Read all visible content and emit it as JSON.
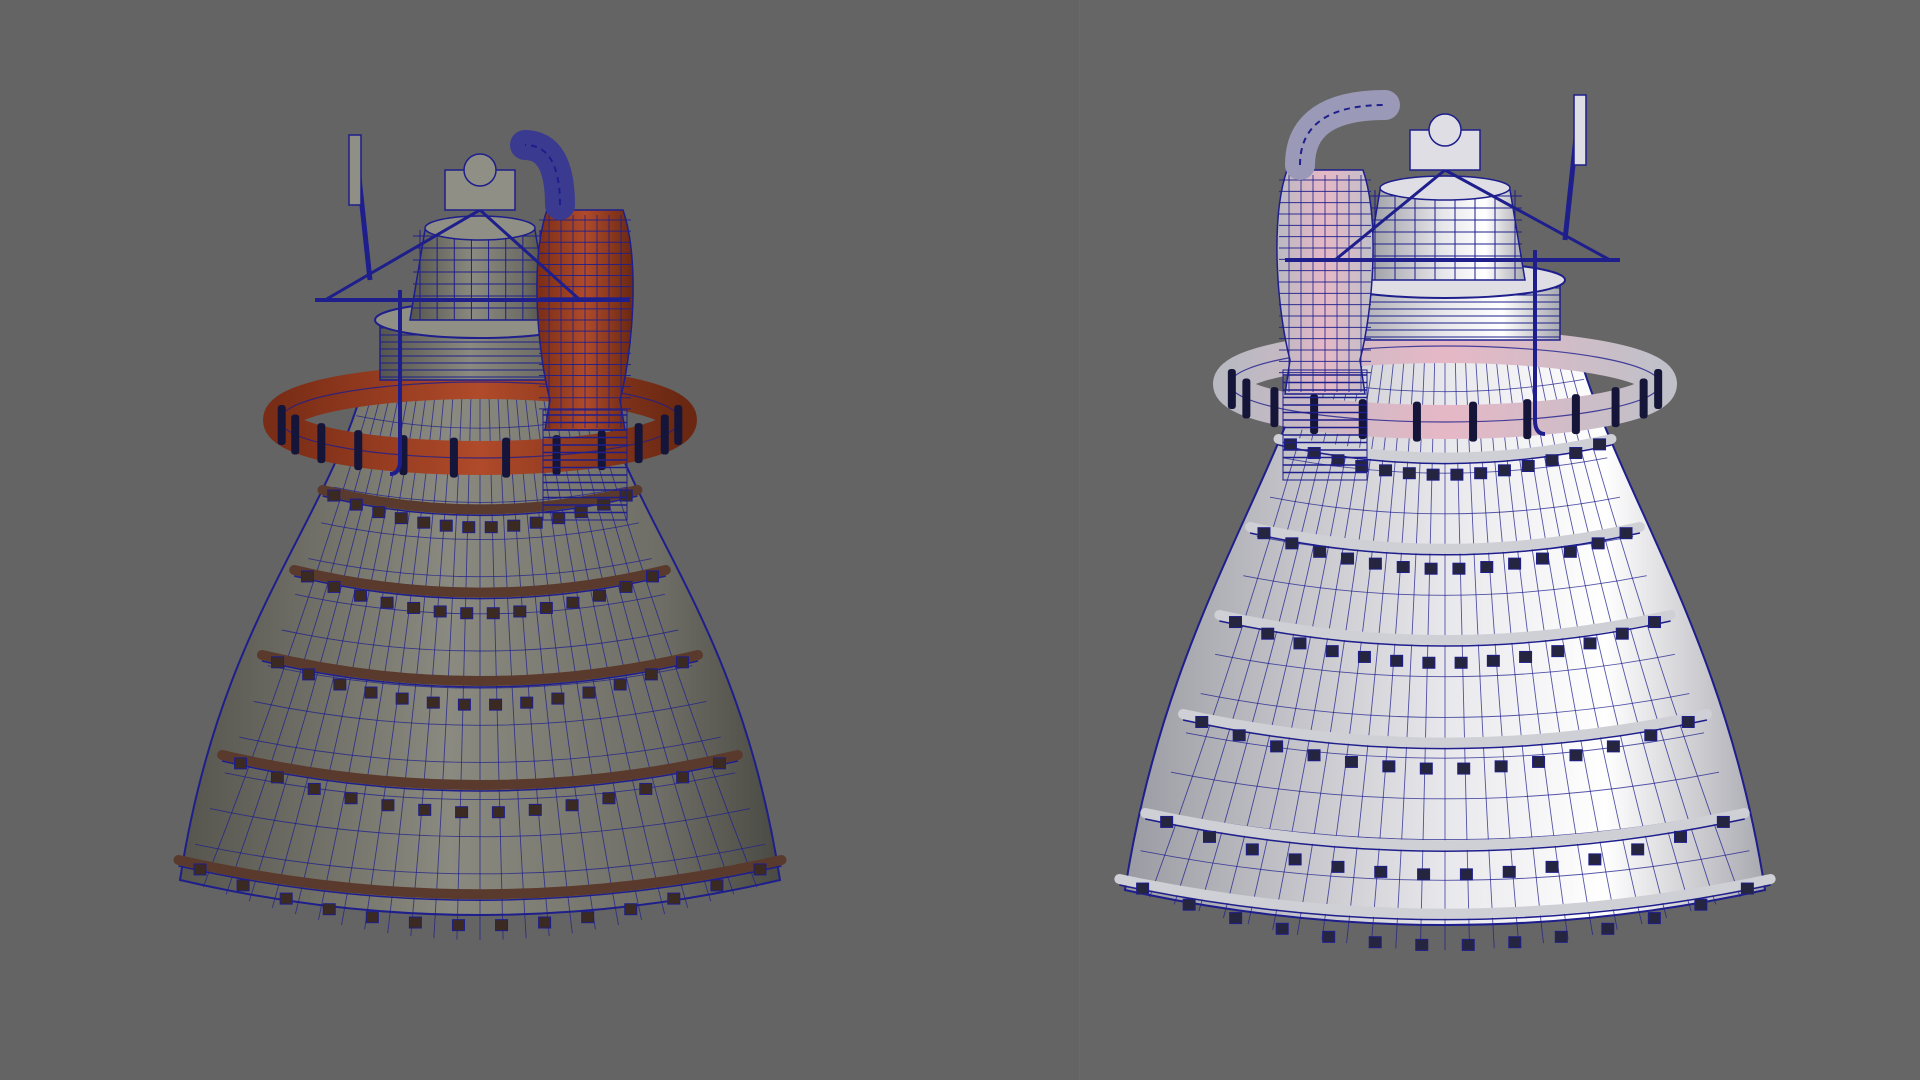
{
  "scene": {
    "background": "#646464",
    "wireframe_color": "#1e1e8c",
    "viewports": [
      {
        "name": "textured-viewport",
        "shading": "textured",
        "model": "rocket-engine",
        "nozzle_color": "#8a8a80",
        "pipe_color": "#b04a2a"
      },
      {
        "name": "smooth-shaded-viewport",
        "shading": "smooth-shaded",
        "model": "rocket-engine",
        "nozzle_color": "#e8e8ec",
        "pipe_color": "#e6b8c6"
      }
    ]
  }
}
